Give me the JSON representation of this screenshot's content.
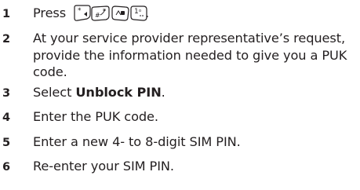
{
  "steps": [
    {
      "num": "1",
      "prefix": "Press ",
      "suffix": ".",
      "keys": [
        "star-key-icon",
        "hash-key-icon",
        "zero-key-icon",
        "one-key-icon"
      ]
    },
    {
      "num": "2",
      "lines": [
        "At your service provider representative’s request,",
        "provide the information needed to give you a PUK",
        "code."
      ]
    },
    {
      "num": "3",
      "prefix": "Select ",
      "bold": "Unblock PIN",
      "suffix": "."
    },
    {
      "num": "4",
      "text": "Enter the PUK code."
    },
    {
      "num": "5",
      "text": "Enter a new 4- to 8-digit SIM PIN."
    },
    {
      "num": "6",
      "text": "Re-enter your SIM PIN."
    }
  ]
}
